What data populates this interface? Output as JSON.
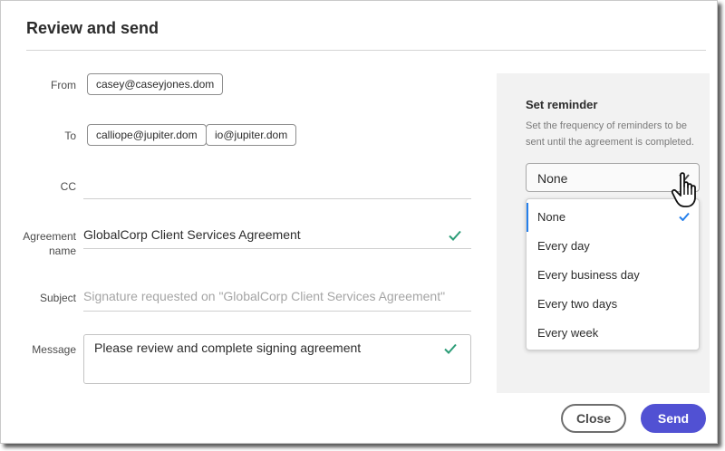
{
  "dialog": {
    "title": "Review and send"
  },
  "form": {
    "from": {
      "label": "From",
      "chips": [
        "casey@caseyjones.dom"
      ]
    },
    "to": {
      "label": "To",
      "chips": [
        "calliope@jupiter.dom",
        "io@jupiter.dom"
      ]
    },
    "cc": {
      "label": "CC",
      "value": ""
    },
    "agreement_name": {
      "label_line1": "Agreement",
      "label_line2": "name",
      "value": "GlobalCorp Client Services Agreement"
    },
    "subject": {
      "label": "Subject",
      "placeholder": "Signature requested on \"GlobalCorp Client Services Agreement\""
    },
    "message": {
      "label": "Message",
      "value": "Please review and complete signing agreement"
    }
  },
  "reminder": {
    "title": "Set reminder",
    "description": "Set the frequency of reminders to be sent until the agreement is completed.",
    "selected": "None",
    "options": [
      "None",
      "Every day",
      "Every business day",
      "Every two days",
      "Every week"
    ]
  },
  "actions": {
    "close_label": "Close",
    "send_label": "Send"
  },
  "colors": {
    "accent": "#5151d3",
    "check_green": "#2d9d78",
    "menu_accent": "#2680eb"
  }
}
